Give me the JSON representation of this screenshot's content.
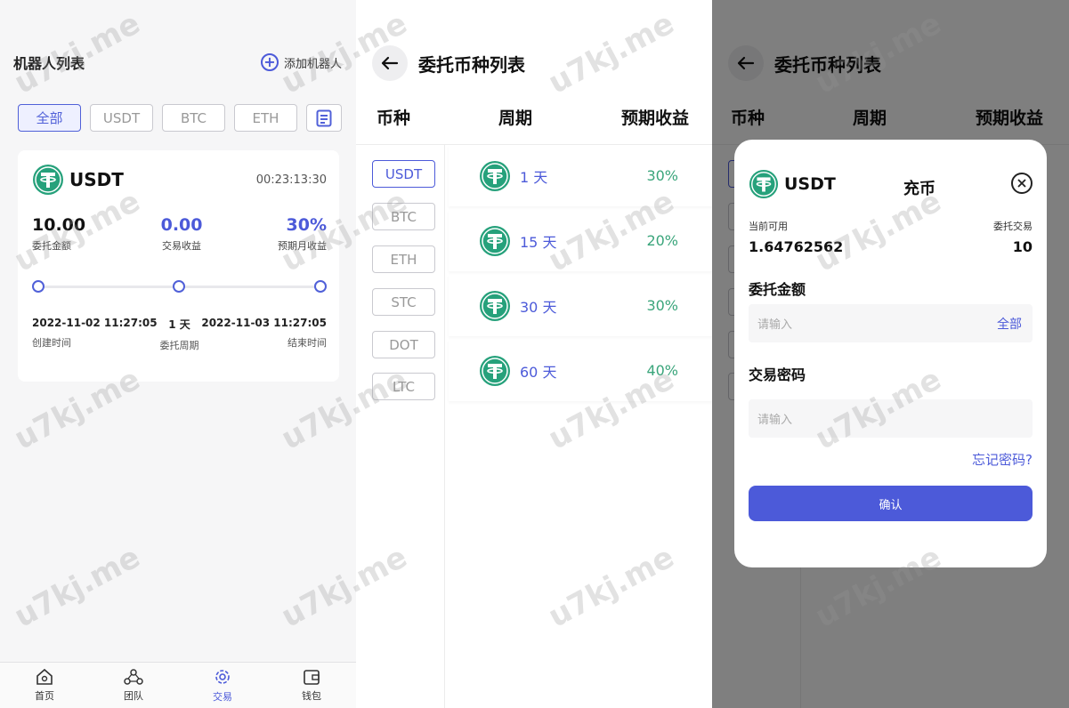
{
  "panel1": {
    "title": "机器人列表",
    "add_robot": "添加机器人",
    "filters": [
      "全部",
      "USDT",
      "BTC",
      "ETH"
    ],
    "card": {
      "coin": "USDT",
      "timer": "00:23:13:30",
      "stat_amount_value": "10.00",
      "stat_amount_label": "委托金额",
      "stat_profit_value": "0.00",
      "stat_profit_label": "交易收益",
      "stat_monthly_value": "30%",
      "stat_monthly_label": "预期月收益",
      "created_value": "2022-11-02 11:27:05",
      "created_label": "创建时间",
      "period_value": "1 天",
      "period_label": "委托周期",
      "end_value": "2022-11-03 11:27:05",
      "end_label": "结束时间"
    },
    "nav": {
      "home": "首页",
      "team": "团队",
      "trade": "交易",
      "wallet": "钱包"
    }
  },
  "panel2": {
    "title": "委托币种列表",
    "col_coin": "币种",
    "col_period": "周期",
    "col_return": "预期收益",
    "coins": [
      "USDT",
      "BTC",
      "ETH",
      "STC",
      "DOT",
      "LTC"
    ],
    "periods": [
      {
        "days": "1 天",
        "rate": "30%"
      },
      {
        "days": "15 天",
        "rate": "20%"
      },
      {
        "days": "30 天",
        "rate": "30%"
      },
      {
        "days": "60 天",
        "rate": "40%"
      }
    ]
  },
  "modal": {
    "coin": "USDT",
    "title": "充币",
    "available_label": "当前可用",
    "available_value": "1.64762562",
    "trade_label": "委托交易",
    "trade_value": "10",
    "amount_label": "委托金额",
    "amount_placeholder": "请输入",
    "all_label": "全部",
    "password_label": "交易密码",
    "password_placeholder": "请输入",
    "forgot": "忘记密码?",
    "confirm": "确认"
  },
  "watermark": "u7kj.me",
  "colors": {
    "accent": "#4c5ad9",
    "tether": "#26a17b",
    "profit": "#3aa57b"
  }
}
